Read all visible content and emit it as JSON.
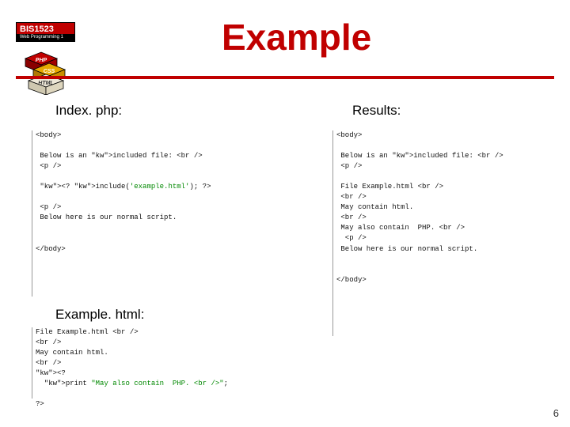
{
  "header": {
    "course_code": "BIS1523",
    "course_title": "Web Programming 1"
  },
  "title": "Example",
  "labels": {
    "index": "Index. php:",
    "results": "Results:",
    "example_html": "Example. html:"
  },
  "code": {
    "index_php": "<body>\n\n Below is an included file: <br />\n <p />\n\n <? include('example.html'); ?>\n\n <p />\n Below here is our normal script.\n\n\n</body>",
    "results": "<body>\n\n Below is an included file: <br />\n <p />\n\n File Example.html <br />\n <br />\n May contain html.\n <br />\n May also contain  PHP. <br />\n  <p />\n Below here is our normal script.\n\n\n</body>",
    "example_html": "File Example.html <br />\n<br />\nMay contain html.\n<br />\n<?\n  print \"May also contain  PHP. <br />\";\n\n?>"
  },
  "page_number": "6",
  "logo_bricks": [
    {
      "label": "PHP",
      "color": "#c00000"
    },
    {
      "label": "CSS",
      "color": "#e6a800"
    },
    {
      "label": "HTML",
      "color": "#e0dccc"
    }
  ]
}
